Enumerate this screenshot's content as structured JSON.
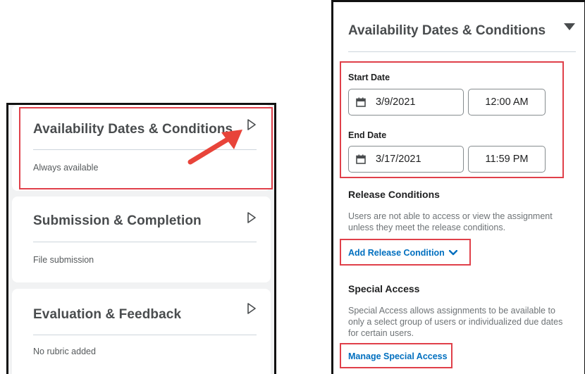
{
  "left_cards": [
    {
      "title": "Availability Dates & Conditions",
      "subtitle": "Always available"
    },
    {
      "title": "Submission & Completion",
      "subtitle": "File submission"
    },
    {
      "title": "Evaluation & Feedback",
      "subtitle": "No rubric added"
    }
  ],
  "right_panel": {
    "title": "Availability Dates & Conditions",
    "start_date": {
      "label": "Start Date",
      "date": "3/9/2021",
      "time": "12:00 AM"
    },
    "end_date": {
      "label": "End Date",
      "date": "3/17/2021",
      "time": "11:59 PM"
    },
    "release_conditions": {
      "heading": "Release Conditions",
      "description": "Users are not able to access or view the assignment unless they meet the release conditions.",
      "link": "Add Release Condition"
    },
    "special_access": {
      "heading": "Special Access",
      "description": "Special Access allows assignments to be available to only a select group of users or individualized due dates for certain users.",
      "link": "Manage Special Access"
    }
  },
  "colors": {
    "highlight": "#e0404a",
    "link": "#006fbf",
    "text": "#494c4e",
    "panel_background": "#f1f2f3"
  },
  "icons": {
    "expand": "triangle-right-outline-icon",
    "collapse": "triangle-down-icon",
    "calendar": "calendar-icon",
    "chevron": "chevron-down-icon",
    "pointer": "red-arrow-annotation"
  }
}
